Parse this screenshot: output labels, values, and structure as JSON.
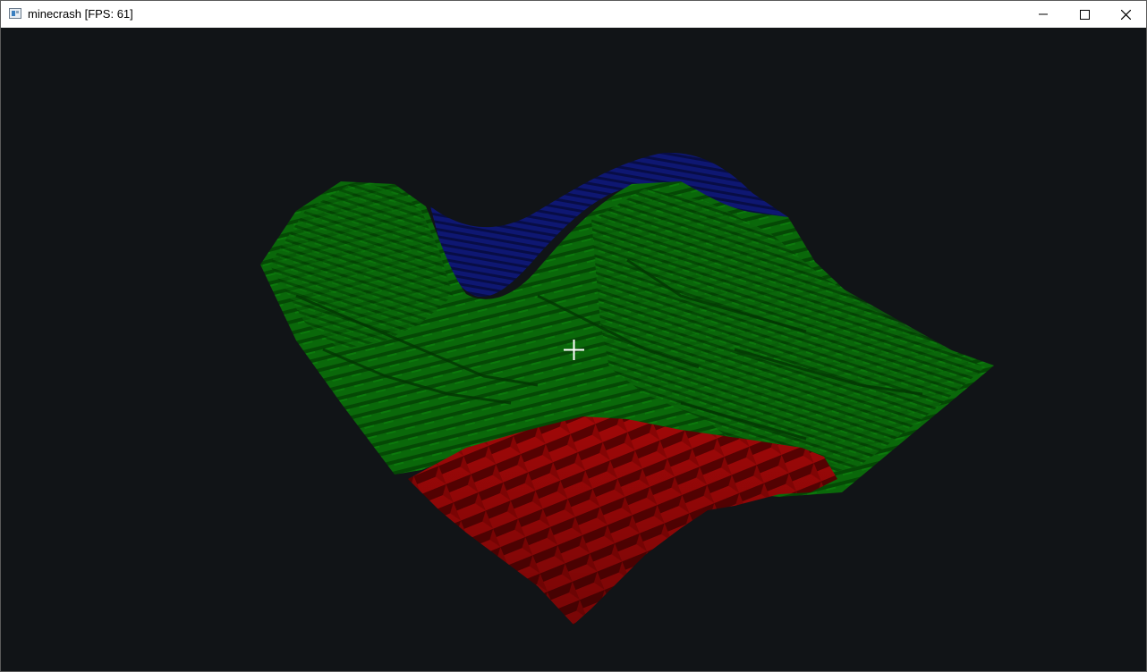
{
  "window": {
    "title": "minecrash [FPS: 61]",
    "icon": "app-window-icon",
    "controls": [
      {
        "name": "minimize",
        "icon": "minimize-icon"
      },
      {
        "name": "maximize",
        "icon": "maximize-icon"
      },
      {
        "name": "close",
        "icon": "close-icon"
      }
    ]
  },
  "scene": {
    "background_color": "#111417",
    "terrain_colors": {
      "grass": "#0b6a0b",
      "grass_dark": "#033f03",
      "water": "#0e1673",
      "lava": "#8b0505"
    },
    "crosshair": "crosshair-icon"
  }
}
